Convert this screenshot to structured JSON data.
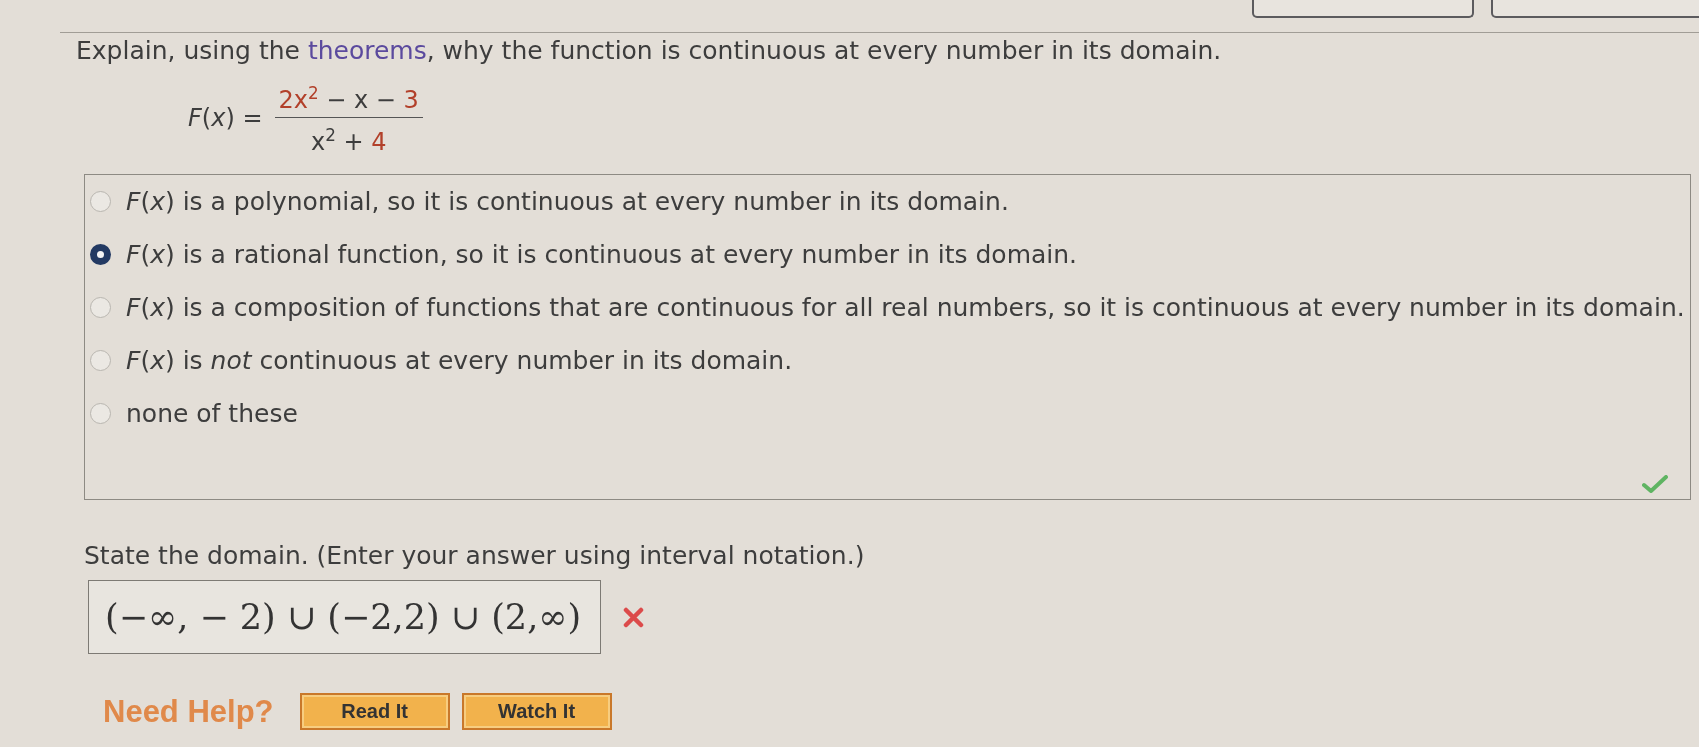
{
  "question": {
    "before": "Explain, using the ",
    "link": "theorems",
    "after": ", why the function is continuous at every number in its domain."
  },
  "formula": {
    "lhs": "*F*(*x*) =",
    "numerator": [
      {
        "text": "2x$^{2}$",
        "highlighted": true
      },
      {
        "text": " − x − ",
        "highlighted": false
      },
      {
        "text": "3",
        "highlighted": true
      }
    ],
    "denominator": [
      {
        "text": "x$^{2}$ + ",
        "highlighted": false
      },
      {
        "text": "4",
        "highlighted": true
      }
    ]
  },
  "choices": {
    "correct": true,
    "items": [
      {
        "text": "*F*(*x*) is a polynomial, so it is continuous at every number in its domain.",
        "selected": false
      },
      {
        "text": "*F*(*x*) is a rational function, so it is continuous at every number in its domain.",
        "selected": true
      },
      {
        "text": "*F*(*x*) is a composition of functions that are continuous for all real numbers, so it is continuous at every number in its domain.",
        "selected": false
      },
      {
        "text": "*F*(*x*) is *not* continuous at every number in its domain.",
        "selected": false
      },
      {
        "text": "none of these",
        "selected": false
      }
    ]
  },
  "domain": {
    "prompt": "State the domain. (Enter your answer using interval notation.)",
    "answer": "(−∞, − 2) ∪ (−2,2) ∪ (2,∞)",
    "correct": false
  },
  "help": {
    "label": "Need Help?",
    "buttons": [
      "Read It",
      "Watch It"
    ]
  }
}
